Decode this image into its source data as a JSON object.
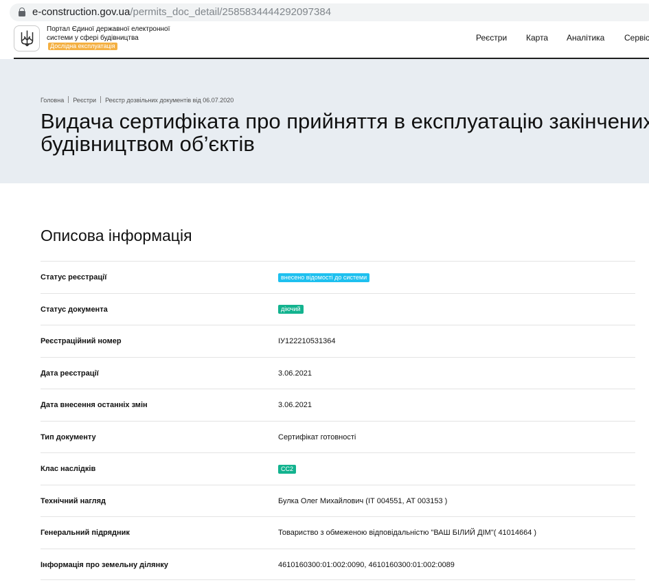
{
  "browser": {
    "url_host": "e-construction.gov.ua",
    "url_path": "/permits_doc_detail/2585834444292097384"
  },
  "header": {
    "emblem_icon": "trident-emblem-icon",
    "portal_name": "Портал Єдиної державної електронної системи у сфері будівництва",
    "trial_badge": "Дослідна експлуатація",
    "trial_badge_color": "#f4b042",
    "nav": [
      {
        "label": "Реєстри"
      },
      {
        "label": "Карта"
      },
      {
        "label": "Аналітика"
      },
      {
        "label": "Сервіс"
      }
    ]
  },
  "hero": {
    "breadcrumb": [
      "Головна",
      "Реєстри",
      "Реєстр дозвільних документів від 06.07.2020"
    ],
    "title": "Видача сертифіката про прийняття в експлуатацію закінчених будівництвом об’єктів"
  },
  "main": {
    "section_title": "Описова інформація",
    "rows": [
      {
        "label": "Статус реєстрації",
        "value": "внесено відомості до системи",
        "tag_color": "#1ec0ef"
      },
      {
        "label": "Статус документа",
        "value": "діючий",
        "tag_color": "#13b38f"
      },
      {
        "label": "Реєстраційний номер",
        "value": "ІУ122210531364"
      },
      {
        "label": "Дата реєстрації",
        "value": "3.06.2021"
      },
      {
        "label": "Дата внесення останніх змін",
        "value": "3.06.2021"
      },
      {
        "label": "Тип документу",
        "value": "Сертифікат готовності"
      },
      {
        "label": "Клас наслідків",
        "value": "СС2",
        "tag_color": "#13b38f"
      },
      {
        "label": "Технічний нагляд",
        "value": "Булка Олег Михайлович (ІТ 004551, АТ 003153 )"
      },
      {
        "label": "Генеральний підрядник",
        "value": "Товариство з обмеженою відповідальністю \"ВАШ БІЛИЙ ДІМ\"( 41014664 )"
      },
      {
        "label": "Інформація про земельну ділянку",
        "value": "4610160300:01:002:0090, 4610160300:01:002:0089"
      }
    ]
  }
}
